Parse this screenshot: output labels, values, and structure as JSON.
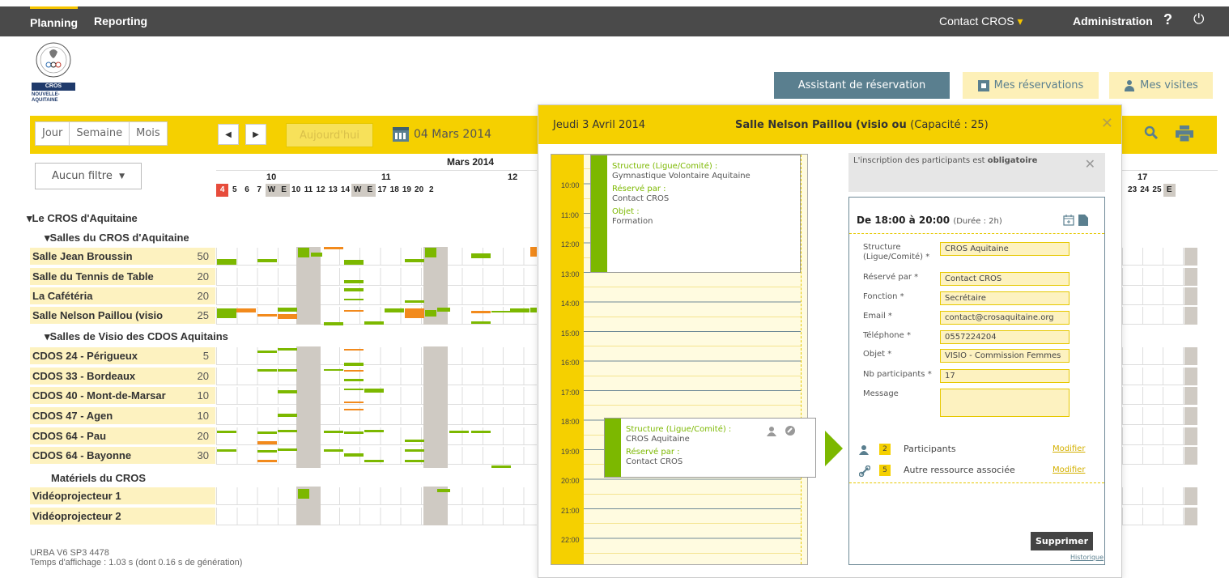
{
  "nav": {
    "tabs": [
      "Planning",
      "Reporting"
    ],
    "user_menu": "Contact CROS",
    "admin": "Administration",
    "help_icon": "?",
    "power_icon": "⏻"
  },
  "logo": {
    "line1": "CROS",
    "line2": "NOUVELLE-",
    "line3": "AQUITAINE"
  },
  "actions": {
    "assistant": "Assistant de réservation",
    "my_reservations": "Mes réservations",
    "my_visits": "Mes visites"
  },
  "toolbar": {
    "views": [
      "Jour",
      "Semaine",
      "Mois"
    ],
    "today": "Aujourd'hui",
    "current_date": "04 Mars 2014",
    "filter": "Aucun filtre"
  },
  "timeline": {
    "month": "Mars 2014",
    "weeks": [
      "10",
      "11",
      "12",
      "17"
    ],
    "days": [
      "4",
      "5",
      "6",
      "7",
      "W",
      "E",
      "10",
      "11",
      "12",
      "13",
      "14",
      "W",
      "E",
      "17",
      "18",
      "19",
      "20",
      "2"
    ],
    "right_days": [
      "23",
      "24",
      "25",
      "E"
    ]
  },
  "tree": {
    "root": "Le CROS d'Aquitaine",
    "group1": "Salles du CROS d'Aquitaine",
    "group2": "Salles de Visio des CDOS Aquitains",
    "group3": "Matériels du CROS",
    "rows": [
      {
        "name": "Salle Jean Broussin",
        "cap": "50"
      },
      {
        "name": "Salle du Tennis de Table",
        "cap": "20"
      },
      {
        "name": "La Cafétéria",
        "cap": "20"
      },
      {
        "name": "Salle Nelson Paillou (visio",
        "cap": "25"
      },
      {
        "name": "CDOS 24 - Périgueux",
        "cap": "5"
      },
      {
        "name": "CDOS 33 - Bordeaux",
        "cap": "20"
      },
      {
        "name": "CDOS 40 - Mont-de-Marsar",
        "cap": "10"
      },
      {
        "name": "CDOS 47 - Agen",
        "cap": "10"
      },
      {
        "name": "CDOS 64 - Pau",
        "cap": "20"
      },
      {
        "name": "CDOS 64 - Bayonne",
        "cap": "30"
      },
      {
        "name": "Vidéoprojecteur 1",
        "cap": ""
      },
      {
        "name": "Vidéoprojecteur 2",
        "cap": ""
      }
    ]
  },
  "footer": {
    "version": "URBA V6 SP3 4478",
    "timing": "Temps d'affichage : 1.03 s (dont 0.16 s de génération)"
  },
  "popup": {
    "date": "Jeudi 3 Avril 2014",
    "room": "Salle Nelson Paillou (visio ou",
    "capacity": "(Capacité : 25)",
    "hours": [
      "10:00",
      "11:00",
      "12:00",
      "13:00",
      "14:00",
      "15:00",
      "16:00",
      "17:00",
      "18:00",
      "19:00",
      "20:00",
      "21:00",
      "22:00"
    ],
    "event1": {
      "k1": "Structure (Ligue/Comité) :",
      "v1": "Gymnastique Volontaire Aquitaine",
      "k2": "Réservé par :",
      "v2": "Contact CROS",
      "k3": "Objet :",
      "v3": "Formation"
    },
    "event2": {
      "k1": "Structure (Ligue/Comité) :",
      "v1": "CROS Aquitaine",
      "k2": "Réservé par :",
      "v2": "Contact CROS"
    },
    "notice_prefix": "L'inscription des participants est ",
    "notice_bold": "obligatoire",
    "detail": {
      "time": "De 18:00 à 20:00",
      "duration": "(Durée : 2h)",
      "fields": [
        {
          "label": "Structure (Ligue/Comité) *",
          "value": "CROS Aquitaine"
        },
        {
          "label": "Réservé par *",
          "value": "Contact CROS"
        },
        {
          "label": "Fonction *",
          "value": "Secrétaire"
        },
        {
          "label": "Email *",
          "value": "contact@crosaquitaine.org"
        },
        {
          "label": "Téléphone *",
          "value": "0557224204"
        },
        {
          "label": "Objet *",
          "value": "VISIO - Commission Femmes"
        },
        {
          "label": "Nb participants *",
          "value": "17"
        },
        {
          "label": "Message",
          "value": ""
        }
      ],
      "participants_count": "2",
      "participants_label": "Participants",
      "resources_count": "5",
      "resources_label": "Autre ressource associée",
      "modify": "Modifier",
      "delete": "Supprimer",
      "history": "Historique"
    }
  },
  "colors": {
    "accent": "#f5d000",
    "green": "#7cb800",
    "orange": "#f28a1c",
    "slate": "#5a7f8f"
  }
}
